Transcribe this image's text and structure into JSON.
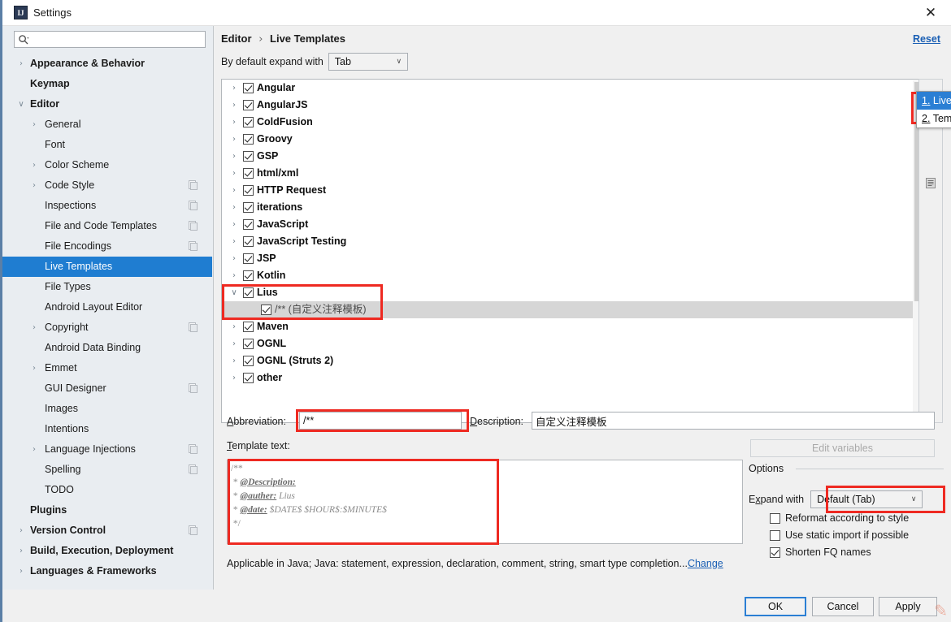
{
  "window": {
    "title": "Settings",
    "app_icon": "IJ",
    "close_icon": "✕"
  },
  "sidebar": {
    "search": {
      "placeholder": "",
      "value": "",
      "icon": "search-icon"
    },
    "items": [
      {
        "label": "Appearance & Behavior",
        "level": 0,
        "bold": true,
        "arrow": "›",
        "selected": false,
        "config_icon": false
      },
      {
        "label": "Keymap",
        "level": 0,
        "bold": true,
        "arrow": "",
        "selected": false,
        "config_icon": false
      },
      {
        "label": "Editor",
        "level": 0,
        "bold": true,
        "arrow": "∨",
        "selected": false,
        "config_icon": false
      },
      {
        "label": "General",
        "level": 1,
        "bold": false,
        "arrow": "›",
        "selected": false,
        "config_icon": false
      },
      {
        "label": "Font",
        "level": 1,
        "bold": false,
        "arrow": "",
        "selected": false,
        "config_icon": false
      },
      {
        "label": "Color Scheme",
        "level": 1,
        "bold": false,
        "arrow": "›",
        "selected": false,
        "config_icon": false
      },
      {
        "label": "Code Style",
        "level": 1,
        "bold": false,
        "arrow": "›",
        "selected": false,
        "config_icon": true
      },
      {
        "label": "Inspections",
        "level": 1,
        "bold": false,
        "arrow": "",
        "selected": false,
        "config_icon": true
      },
      {
        "label": "File and Code Templates",
        "level": 1,
        "bold": false,
        "arrow": "",
        "selected": false,
        "config_icon": true
      },
      {
        "label": "File Encodings",
        "level": 1,
        "bold": false,
        "arrow": "",
        "selected": false,
        "config_icon": true
      },
      {
        "label": "Live Templates",
        "level": 1,
        "bold": false,
        "arrow": "",
        "selected": true,
        "config_icon": false
      },
      {
        "label": "File Types",
        "level": 1,
        "bold": false,
        "arrow": "",
        "selected": false,
        "config_icon": false
      },
      {
        "label": "Android Layout Editor",
        "level": 1,
        "bold": false,
        "arrow": "",
        "selected": false,
        "config_icon": false
      },
      {
        "label": "Copyright",
        "level": 1,
        "bold": false,
        "arrow": "›",
        "selected": false,
        "config_icon": true
      },
      {
        "label": "Android Data Binding",
        "level": 1,
        "bold": false,
        "arrow": "",
        "selected": false,
        "config_icon": false
      },
      {
        "label": "Emmet",
        "level": 1,
        "bold": false,
        "arrow": "›",
        "selected": false,
        "config_icon": false
      },
      {
        "label": "GUI Designer",
        "level": 1,
        "bold": false,
        "arrow": "",
        "selected": false,
        "config_icon": true
      },
      {
        "label": "Images",
        "level": 1,
        "bold": false,
        "arrow": "",
        "selected": false,
        "config_icon": false
      },
      {
        "label": "Intentions",
        "level": 1,
        "bold": false,
        "arrow": "",
        "selected": false,
        "config_icon": false
      },
      {
        "label": "Language Injections",
        "level": 1,
        "bold": false,
        "arrow": "›",
        "selected": false,
        "config_icon": true
      },
      {
        "label": "Spelling",
        "level": 1,
        "bold": false,
        "arrow": "",
        "selected": false,
        "config_icon": true
      },
      {
        "label": "TODO",
        "level": 1,
        "bold": false,
        "arrow": "",
        "selected": false,
        "config_icon": false
      },
      {
        "label": "Plugins",
        "level": 0,
        "bold": true,
        "arrow": "",
        "selected": false,
        "config_icon": false
      },
      {
        "label": "Version Control",
        "level": 0,
        "bold": true,
        "arrow": "›",
        "selected": false,
        "config_icon": true
      },
      {
        "label": "Build, Execution, Deployment",
        "level": 0,
        "bold": true,
        "arrow": "›",
        "selected": false,
        "config_icon": false
      },
      {
        "label": "Languages & Frameworks",
        "level": 0,
        "bold": true,
        "arrow": "›",
        "selected": false,
        "config_icon": false
      }
    ],
    "help_icon": "?"
  },
  "main": {
    "breadcrumb": {
      "parent": "Editor",
      "separator": "›",
      "current": "Live Templates"
    },
    "reset_label": "Reset",
    "default_expand": {
      "label": "By default expand with",
      "value": "Tab",
      "chevron": "∨"
    },
    "template_tree": [
      {
        "name": "Angular",
        "level": 0,
        "checked": true,
        "arrow": "›",
        "highlighted": false
      },
      {
        "name": "AngularJS",
        "level": 0,
        "checked": true,
        "arrow": "›",
        "highlighted": false
      },
      {
        "name": "ColdFusion",
        "level": 0,
        "checked": true,
        "arrow": "›",
        "highlighted": false
      },
      {
        "name": "Groovy",
        "level": 0,
        "checked": true,
        "arrow": "›",
        "highlighted": false
      },
      {
        "name": "GSP",
        "level": 0,
        "checked": true,
        "arrow": "›",
        "highlighted": false
      },
      {
        "name": "html/xml",
        "level": 0,
        "checked": true,
        "arrow": "›",
        "highlighted": false
      },
      {
        "name": "HTTP Request",
        "level": 0,
        "checked": true,
        "arrow": "›",
        "highlighted": false
      },
      {
        "name": "iterations",
        "level": 0,
        "checked": true,
        "arrow": "›",
        "highlighted": false
      },
      {
        "name": "JavaScript",
        "level": 0,
        "checked": true,
        "arrow": "›",
        "highlighted": false
      },
      {
        "name": "JavaScript Testing",
        "level": 0,
        "checked": true,
        "arrow": "›",
        "highlighted": false
      },
      {
        "name": "JSP",
        "level": 0,
        "checked": true,
        "arrow": "›",
        "highlighted": false
      },
      {
        "name": "Kotlin",
        "level": 0,
        "checked": true,
        "arrow": "›",
        "highlighted": false
      },
      {
        "name": "Lius",
        "level": 0,
        "checked": true,
        "arrow": "∨",
        "highlighted": false
      },
      {
        "name": "/** (自定义注释模板)",
        "level": 1,
        "checked": true,
        "arrow": "",
        "highlighted": true
      },
      {
        "name": "Maven",
        "level": 0,
        "checked": true,
        "arrow": "›",
        "highlighted": false
      },
      {
        "name": "OGNL",
        "level": 0,
        "checked": true,
        "arrow": "›",
        "highlighted": false
      },
      {
        "name": "OGNL (Struts 2)",
        "level": 0,
        "checked": true,
        "arrow": "›",
        "highlighted": false
      },
      {
        "name": "other",
        "level": 0,
        "checked": true,
        "arrow": "›",
        "highlighted": false
      }
    ],
    "popup_menu": [
      {
        "mnemonic": "1.",
        "label": "Live",
        "selected": true
      },
      {
        "mnemonic": "2.",
        "label": "Temp",
        "selected": false
      }
    ],
    "abbreviation": {
      "label": "Abbreviation:",
      "mnemonic": "A",
      "value": "/**"
    },
    "description": {
      "label": "Description:",
      "mnemonic": "D",
      "value": "自定义注释模板"
    },
    "template_text_label": "Template text:",
    "template_text_lines": [
      {
        "prefix": "/**",
        "keyword": "",
        "rest": ""
      },
      {
        "prefix": " * ",
        "keyword": "@Description:",
        "rest": ""
      },
      {
        "prefix": " * ",
        "keyword": "@auther:",
        "rest": " Lius"
      },
      {
        "prefix": " * ",
        "keyword": "@date:",
        "rest": " $DATE$ $HOUR$:$MINUTE$"
      },
      {
        "prefix": " */",
        "keyword": "",
        "rest": ""
      }
    ],
    "edit_variables_label": "Edit variables",
    "options": {
      "title": "Options",
      "expand_with": {
        "label": "Expand with",
        "mnemonic": "x",
        "value": "Default (Tab)",
        "chevron": "∨"
      },
      "checkboxes": [
        {
          "label": "Reformat according to style",
          "checked": false
        },
        {
          "label": "Use static import if possible",
          "checked": false
        },
        {
          "label": "Shorten FQ names",
          "checked": true
        }
      ]
    },
    "applicable": {
      "text": "Applicable in Java; Java: statement, expression, declaration, comment, string, smart type completion...",
      "change_link": "Change"
    }
  },
  "buttons": {
    "ok": "OK",
    "cancel": "Cancel",
    "apply": "Apply"
  },
  "colors": {
    "accent_blue": "#1f7dd1",
    "selection_blue": "#2b7fd4",
    "link_blue": "#1a5fb4",
    "annotation_red": "#ee2a22",
    "row_highlight": "#d6d6d6"
  }
}
